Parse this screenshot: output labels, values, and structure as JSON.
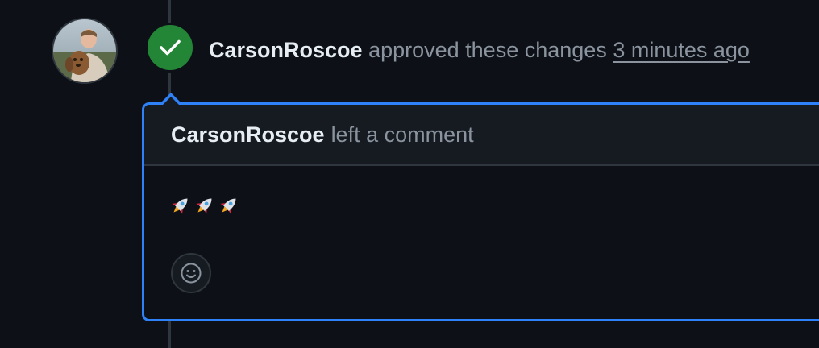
{
  "review_event": {
    "author": "CarsonRoscoe",
    "action_text": "approved these changes",
    "timestamp": "3 minutes ago",
    "status": "approved",
    "status_color": "#238636",
    "avatar_icon": "user-avatar-photo",
    "status_icon": "check-icon"
  },
  "comment": {
    "author": "CarsonRoscoe",
    "header_action": "left a comment",
    "body_icons": [
      "rocket-icon",
      "rocket-icon",
      "rocket-icon"
    ],
    "reaction_icon": "smiley-icon",
    "border_color": "#2f81f7"
  }
}
